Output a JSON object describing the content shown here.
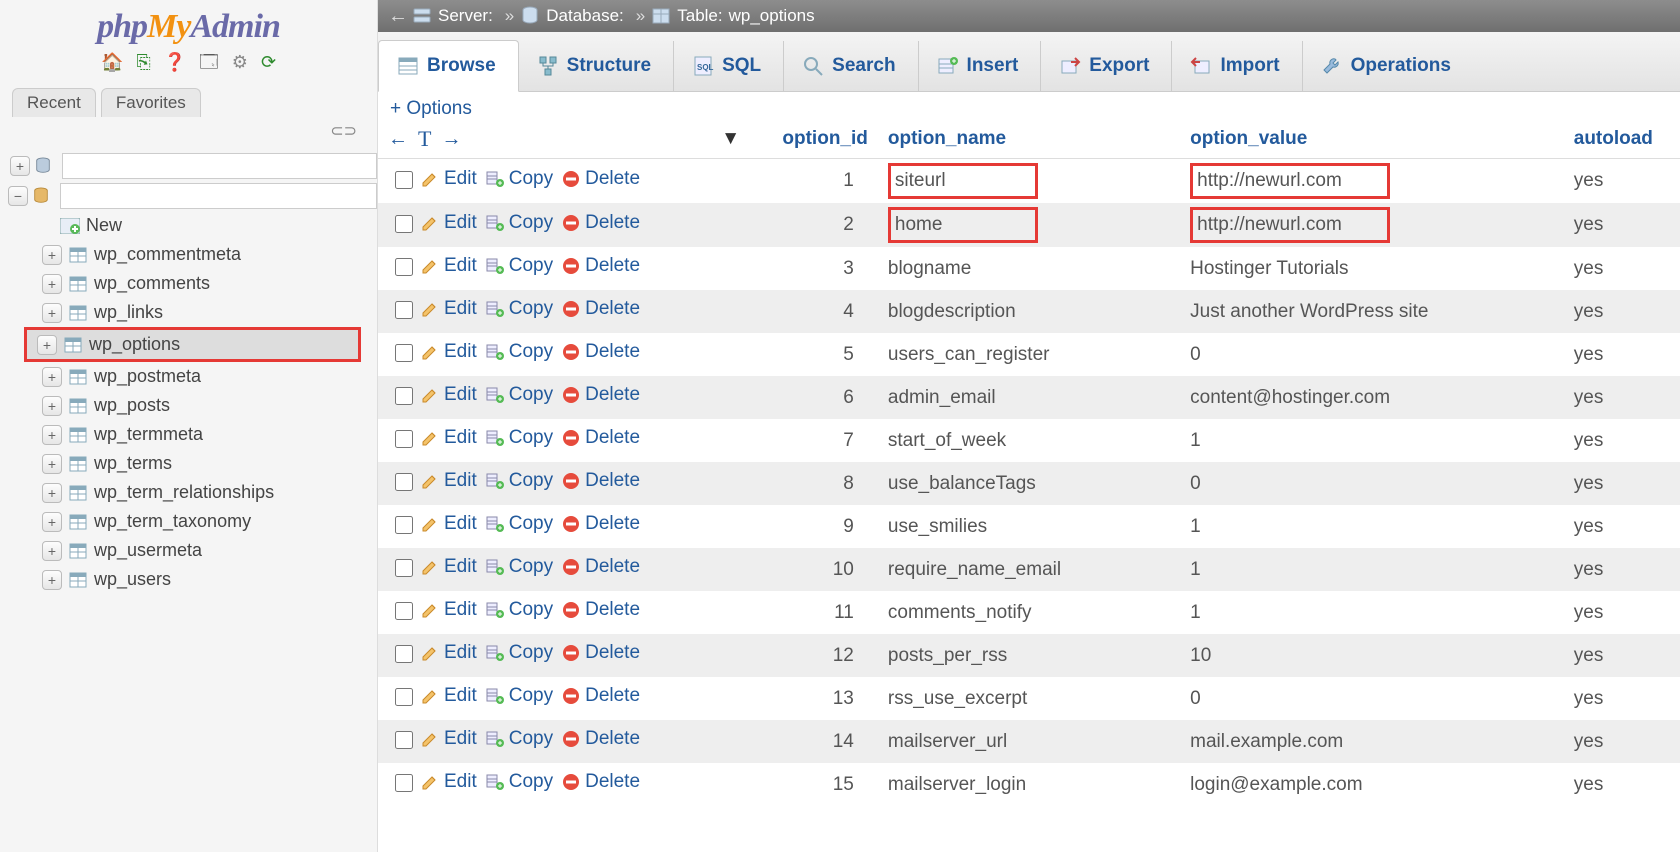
{
  "logo": {
    "p1": "php",
    "p2": "My",
    "p3": "Admin"
  },
  "sidebarTabs": {
    "recent": "Recent",
    "favorites": "Favorites"
  },
  "breadcrumb": {
    "back": "←",
    "server_label": "Server:",
    "server_name": " ",
    "db_label": "Database:",
    "db_name": " ",
    "table_label": "Table:",
    "table_name": "wp_options"
  },
  "tabs": {
    "browse": "Browse",
    "structure": "Structure",
    "sql": "SQL",
    "search": "Search",
    "insert": "Insert",
    "export": "Export",
    "import": "Import",
    "operations": "Operations"
  },
  "optionsLink": "+ Options",
  "columns": {
    "option_id": "option_id",
    "option_name": "option_name",
    "option_value": "option_value",
    "autoload": "autoload"
  },
  "rowActions": {
    "edit": "Edit",
    "copy": "Copy",
    "delete": "Delete"
  },
  "tree": {
    "new": "New",
    "tables": [
      "wp_commentmeta",
      "wp_comments",
      "wp_links",
      "wp_options",
      "wp_postmeta",
      "wp_posts",
      "wp_termmeta",
      "wp_terms",
      "wp_term_relationships",
      "wp_term_taxonomy",
      "wp_usermeta",
      "wp_users"
    ],
    "selected": "wp_options"
  },
  "rows": [
    {
      "id": "1",
      "name": "siteurl",
      "value": "http://newurl.com",
      "autoload": "yes",
      "hl": true
    },
    {
      "id": "2",
      "name": "home",
      "value": "http://newurl.com",
      "autoload": "yes",
      "hl": true
    },
    {
      "id": "3",
      "name": "blogname",
      "value": "Hostinger Tutorials",
      "autoload": "yes"
    },
    {
      "id": "4",
      "name": "blogdescription",
      "value": "Just another WordPress site",
      "autoload": "yes"
    },
    {
      "id": "5",
      "name": "users_can_register",
      "value": "0",
      "autoload": "yes"
    },
    {
      "id": "6",
      "name": "admin_email",
      "value": "content@hostinger.com",
      "autoload": "yes"
    },
    {
      "id": "7",
      "name": "start_of_week",
      "value": "1",
      "autoload": "yes"
    },
    {
      "id": "8",
      "name": "use_balanceTags",
      "value": "0",
      "autoload": "yes"
    },
    {
      "id": "9",
      "name": "use_smilies",
      "value": "1",
      "autoload": "yes"
    },
    {
      "id": "10",
      "name": "require_name_email",
      "value": "1",
      "autoload": "yes"
    },
    {
      "id": "11",
      "name": "comments_notify",
      "value": "1",
      "autoload": "yes"
    },
    {
      "id": "12",
      "name": "posts_per_rss",
      "value": "10",
      "autoload": "yes"
    },
    {
      "id": "13",
      "name": "rss_use_excerpt",
      "value": "0",
      "autoload": "yes"
    },
    {
      "id": "14",
      "name": "mailserver_url",
      "value": "mail.example.com",
      "autoload": "yes"
    },
    {
      "id": "15",
      "name": "mailserver_login",
      "value": "login@example.com",
      "autoload": "yes"
    }
  ]
}
